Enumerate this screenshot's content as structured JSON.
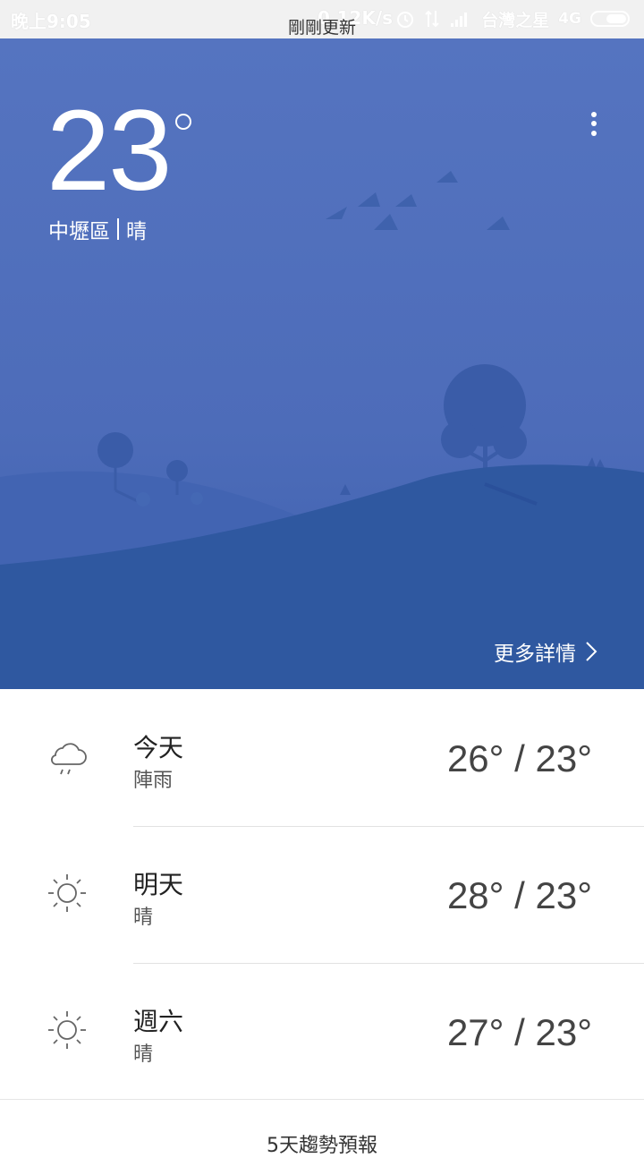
{
  "status_bar": {
    "time": "晚上9:05",
    "net_speed": "0.12K/s",
    "carrier": "台灣之星",
    "network": "4G"
  },
  "toast": "剛剛更新",
  "weather": {
    "temperature": "23",
    "location": "中壢區",
    "condition": "晴",
    "more_details": "更多詳情"
  },
  "forecast": [
    {
      "day": "今天",
      "condition": "陣雨",
      "range": "26° / 23°",
      "icon": "rain-cloud-icon"
    },
    {
      "day": "明天",
      "condition": "晴",
      "range": "28° / 23°",
      "icon": "sun-icon"
    },
    {
      "day": "週六",
      "condition": "晴",
      "range": "27° / 23°",
      "icon": "sun-icon"
    }
  ],
  "footer": "5天趨勢預報",
  "colors": {
    "sky": "#5574c0",
    "hill": "#2f58a0",
    "text": "#ffffff"
  }
}
